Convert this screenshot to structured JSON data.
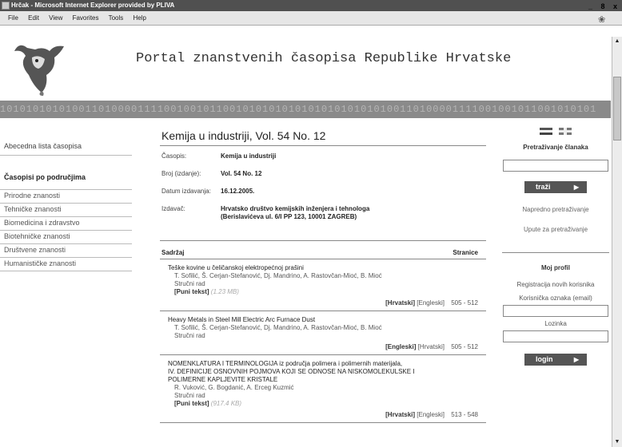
{
  "window": {
    "title": "Hrčak - Microsoft Internet Explorer provided by PLIVA",
    "controls": "_ 8 x"
  },
  "menu": [
    "File",
    "Edit",
    "View",
    "Favorites",
    "Tools",
    "Help"
  ],
  "header": {
    "portal_title": "Portal znanstvenih časopisa Republike Hrvatske",
    "binary_strip": "1010101010100110100001111001001011001010101010101010101010100110100001111001001011001010101"
  },
  "leftnav": {
    "alphabetical": "Abecedna lista časopisa",
    "by_field": "Časopisi po područjima",
    "categories": [
      "Prirodne znanosti",
      "Tehničke znanosti",
      "Biomedicina i zdravstvo",
      "Biotehničke znanosti",
      "Društvene znanosti",
      "Humanističke znanosti"
    ]
  },
  "main": {
    "title": "Kemija u industriji, Vol. 54 No. 12",
    "meta": {
      "casopis_label": "Časopis:",
      "casopis_value": "Kemija u industriji",
      "broj_label": "Broj (izdanje):",
      "broj_value": "Vol. 54 No. 12",
      "datum_label": "Datum izdavanja:",
      "datum_value": "16.12.2005.",
      "izdavac_label": "Izdavač:",
      "izdavac_line1": "Hrvatsko društvo kemijskih inženjera i tehnologa",
      "izdavac_line2": "(Berislavićeva ul. 6/I PP 123, 10001 ZAGREB)"
    },
    "contents_label": "Sadržaj",
    "pages_label": "Stranice",
    "articles": [
      {
        "title": "Teške kovine u čeličanskoj elektropećnoj prašini",
        "authors": "T. Sofilić, Š. Cerjan-Stefanović, Dj. Mandrino, A. Rastovčan-Mioć, B. Mioć",
        "type": "Stručni rad",
        "fulltext": "[Puni tekst]",
        "size": "(1.23 MB)",
        "lang_active": "[Hrvatski]",
        "lang_other": "[Engleski]",
        "pages": "505 - 512"
      },
      {
        "title": "Heavy Metals in Steel Mill Electric Arc Furnace Dust",
        "authors": "T. Sofilić, Š. Cerjan-Stefanović, Dj. Mandrino, A. Rastovčan-Mioć, B. Mioć",
        "type": "Stručni rad",
        "lang_active": "[Engleski]",
        "lang_other": "[Hrvatski]",
        "pages": "505 - 512"
      },
      {
        "title_line1": "NOMENKLATURA I TERMINOLOGIJA iz područja polimera i polimernih materijala,",
        "title_line2": "IV. DEFINICIJE OSNOVNIH POJMOVA KOJI SE ODNOSE NA NISKOMOLEKULSKE I",
        "title_line3": "POLIMERNE KAPLJEVITE KRISTALE",
        "authors": "R. Vuković, G. Bogdanić, A. Erceg Kuzmić",
        "type": "Stručni rad",
        "fulltext": "[Puni tekst]",
        "size": "(917.4 KB)",
        "lang_active": "[Hrvatski]",
        "lang_other": "[Engleski]",
        "pages": "513 - 548"
      }
    ]
  },
  "right": {
    "search_heading": "Pretraživanje članaka",
    "search_button": "traži",
    "advanced_search": "Napredno pretraživanje",
    "search_help": "Upute za pretraživanje",
    "profile_heading": "Moj profil",
    "register": "Registracija novih korisnika",
    "user_label": "Korisnička oznaka (email)",
    "password_label": "Lozinka",
    "login_button": "login"
  }
}
